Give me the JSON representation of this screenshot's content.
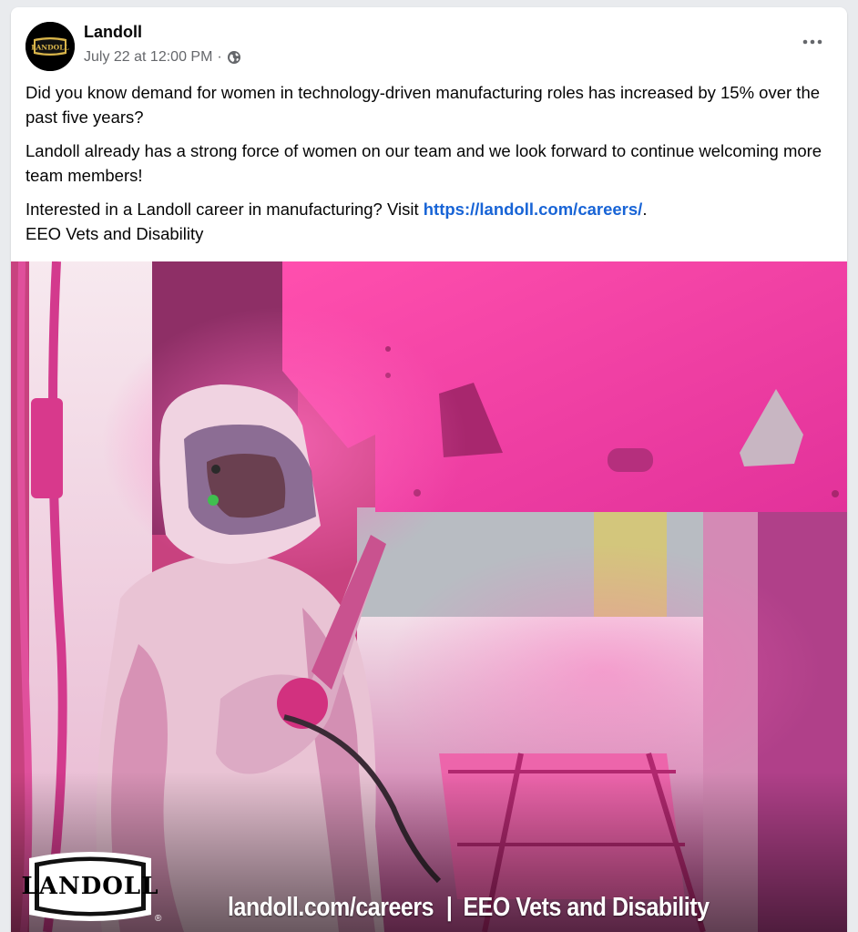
{
  "post": {
    "page_name": "Landoll",
    "date": "July 22 at 12:00 PM",
    "separator": "·",
    "avatar_logo_text": "LANDOLL",
    "more_icon": "more-horizontal-icon",
    "audience_icon": "globe-icon"
  },
  "body": {
    "paragraph1": "Did you know demand for women in technology-driven manufacturing roles has increased by 15% over the past five years?",
    "paragraph2": "Landoll already has a strong force of women on our team and we look forward to continue welcoming more team members!",
    "paragraph3_prefix": "Interested in a Landoll career in manufacturing? Visit ",
    "paragraph3_link": "https://landoll.com/careers/",
    "paragraph3_suffix": ".",
    "paragraph4": "EEO Vets and Disability",
    "link_color": "#1864d6"
  },
  "image": {
    "logo_text": "LANDOLL",
    "registered_mark": "®",
    "caption_left": "landoll.com/careers",
    "caption_divider": "|",
    "caption_right": "EEO Vets and Disability",
    "dominant_color": "#e0429a"
  }
}
